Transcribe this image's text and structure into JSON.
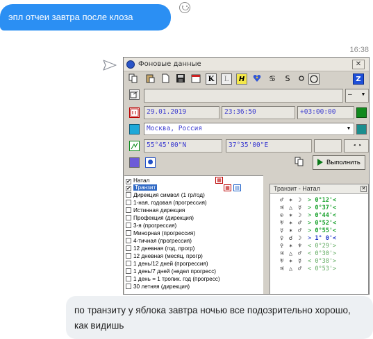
{
  "chat": {
    "outgoing_text": "эпл отчеи завтра после клоза",
    "timestamp": "16:38",
    "incoming_text": "по транзиту у яблока завтра ночью все подозрительно хорошо, как видишь"
  },
  "window": {
    "title": "Фоновые данные",
    "close": "✕",
    "toolbar": {
      "k_label": "K",
      "l_label": "L",
      "h_label": "H",
      "z_label": "Z"
    },
    "date": "29.01.2019",
    "time": "23:36:50",
    "tz": "+03:00:00",
    "place": "Москва, Россия",
    "lat": "55°45'00\"N",
    "lon": "37°35'00\"E",
    "dash": "–",
    "execute_label": "Выполнить"
  },
  "list_items": [
    {
      "label": "Натал",
      "checked": "✔"
    },
    {
      "label": "Транзит",
      "checked": "✔"
    },
    {
      "label": "Дирекция символ (1 гр/год)",
      "checked": ""
    },
    {
      "label": "1-ная, годовая (прогрессия)",
      "checked": ""
    },
    {
      "label": "Истинная дирекция",
      "checked": ""
    },
    {
      "label": "Профекция (дирекция)",
      "checked": ""
    },
    {
      "label": "3-я (прогрессия)",
      "checked": ""
    },
    {
      "label": "Минорная (прогрессия)",
      "checked": ""
    },
    {
      "label": "4-тичная (прогрессия)",
      "checked": ""
    },
    {
      "label": "12 дневная (год, прогр)",
      "checked": ""
    },
    {
      "label": "12 дневная (месяц, прогр)",
      "checked": ""
    },
    {
      "label": "1 день/12 дней (прогрессия)",
      "checked": ""
    },
    {
      "label": "1 день/7 дней (недел прогресс)",
      "checked": ""
    },
    {
      "label": "1 день = 1 тропик. год (прогресс)",
      "checked": ""
    },
    {
      "label": "30 летняя (дирекция)",
      "checked": ""
    }
  ],
  "transit_panel": {
    "title": "Транзит - Натал",
    "close": "✕",
    "rows": [
      {
        "p1": "♂",
        "asp": "✶",
        "p2": "☽",
        "dir": ">",
        "val": "0°12'<",
        "style": "g"
      },
      {
        "p1": "♃",
        "asp": "△",
        "p2": "☿",
        "dir": ">",
        "val": "0°37'<",
        "style": "g"
      },
      {
        "p1": "⊙",
        "asp": "✶",
        "p2": "☽",
        "dir": ">",
        "val": "0°44'<",
        "style": "g"
      },
      {
        "p1": "♅",
        "asp": "✶",
        "p2": "♂",
        "dir": ">",
        "val": "0°52'<",
        "style": "g"
      },
      {
        "p1": "☿",
        "asp": "✶",
        "p2": "♂",
        "dir": ">",
        "val": "0°55'<",
        "style": "g"
      },
      {
        "p1": "♀",
        "asp": "☌",
        "p2": "☽",
        "dir": ">",
        "val": "1° 0'<",
        "style": "b"
      },
      {
        "p1": "♀",
        "asp": "✶",
        "p2": "♆",
        "dir": "<",
        "val": "0°29'>",
        "style": "l"
      },
      {
        "p1": "♃",
        "asp": "△",
        "p2": "♂",
        "dir": "<",
        "val": "0°30'>",
        "style": "l"
      },
      {
        "p1": "♅",
        "asp": "✶",
        "p2": "☿",
        "dir": "<",
        "val": "0°38'>",
        "style": "l"
      },
      {
        "p1": "♃",
        "asp": "△",
        "p2": "♂",
        "dir": "<",
        "val": "0°53'>",
        "style": "l"
      }
    ]
  }
}
